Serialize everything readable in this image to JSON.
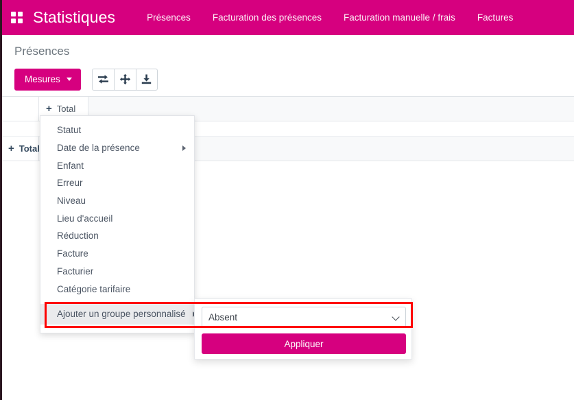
{
  "navbar": {
    "apps_icon": "apps-grid-icon",
    "brand": "Statistiques",
    "links": [
      {
        "label": "Présences"
      },
      {
        "label": "Facturation des présences"
      },
      {
        "label": "Facturation manuelle / frais"
      },
      {
        "label": "Factures"
      }
    ]
  },
  "page": {
    "title": "Présences"
  },
  "toolbar": {
    "measures_label": "Mesures",
    "caret_icon": "caret-down-icon",
    "buttons": [
      {
        "icon": "flip-axis-icon"
      },
      {
        "icon": "expand-all-icon"
      },
      {
        "icon": "download-icon"
      }
    ]
  },
  "pivot": {
    "plus": "+",
    "column_header": "Total",
    "row_header": "Total"
  },
  "menu": {
    "items": [
      {
        "label": "Statut",
        "has_submenu": false
      },
      {
        "label": "Date de la présence",
        "has_submenu": true
      },
      {
        "label": "Enfant",
        "has_submenu": false
      },
      {
        "label": "Erreur",
        "has_submenu": false
      },
      {
        "label": "Niveau",
        "has_submenu": false
      },
      {
        "label": "Lieu d'accueil",
        "has_submenu": false
      },
      {
        "label": "Réduction",
        "has_submenu": false
      },
      {
        "label": "Facture",
        "has_submenu": false
      },
      {
        "label": "Facturier",
        "has_submenu": false
      },
      {
        "label": "Catégorie tarifaire",
        "has_submenu": false
      }
    ],
    "custom_group": {
      "label": "Ajouter un groupe personnalisé",
      "arrow_icon": "caret-right-icon"
    }
  },
  "submenu": {
    "select_value": "Absent",
    "select_options": [
      "Absent"
    ],
    "chevron_icon": "chevron-down-icon",
    "apply_label": "Appliquer"
  },
  "colors": {
    "brand_magenta": "#d6007f",
    "highlight_red": "#fe0000",
    "page_background": "#f7f8fa",
    "menu_highlight": "#eaebed"
  }
}
